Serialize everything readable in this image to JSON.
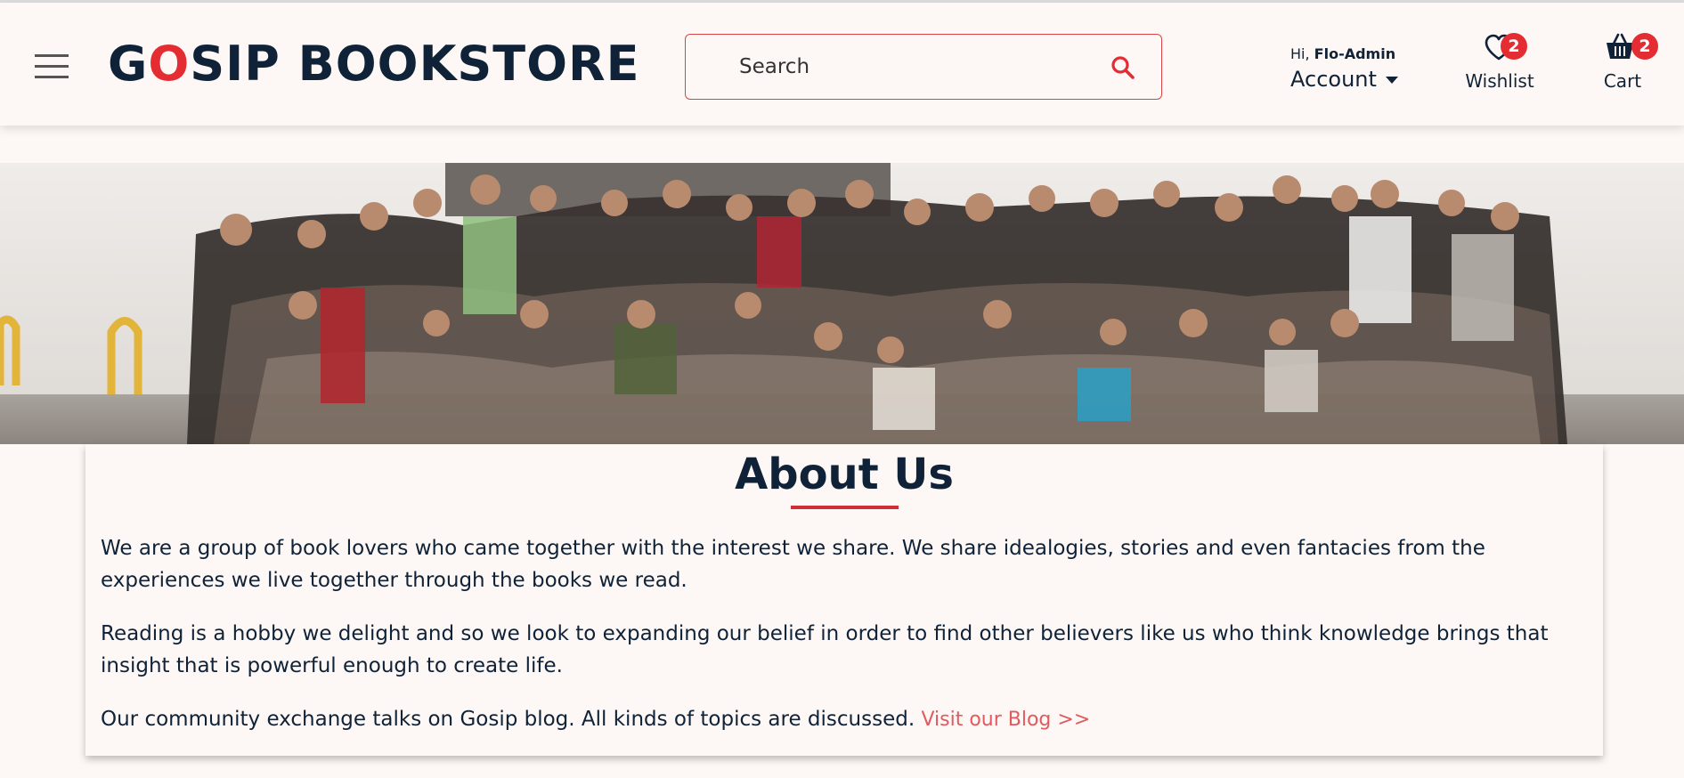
{
  "header": {
    "logo": {
      "part1": "G",
      "accent": "O",
      "part2": "SIP BOOKSTORE"
    },
    "search": {
      "placeholder": "Search"
    },
    "account": {
      "greeting": "Hi,",
      "username": "Flo-Admin",
      "label": "Account"
    },
    "wishlist": {
      "label": "Wishlist",
      "count": "2"
    },
    "cart": {
      "label": "Cart",
      "count": "2"
    }
  },
  "hero": {
    "image": "group-photo"
  },
  "about": {
    "title": "About Us",
    "paragraph1": "We are a group of book lovers who came together with the interest we share. We share idealogies, stories and even fantacies from the experiences we live together through the books we read.",
    "paragraph2": "Reading is a hobby we delight and so we look to expanding our belief in order to find other believers like us who think knowledge brings that insight that is powerful enough to create life.",
    "paragraph3": "Our community exchange talks on Gosip blog. All kinds of topics are discussed.",
    "blog_link": "Visit our Blog >>"
  },
  "colors": {
    "brand_navy": "#0f2238",
    "accent_red": "#e32d33",
    "background": "#fdf8f5"
  },
  "icons": [
    "menu-icon",
    "search-icon",
    "caret-down-icon",
    "heart-icon",
    "basket-icon"
  ]
}
